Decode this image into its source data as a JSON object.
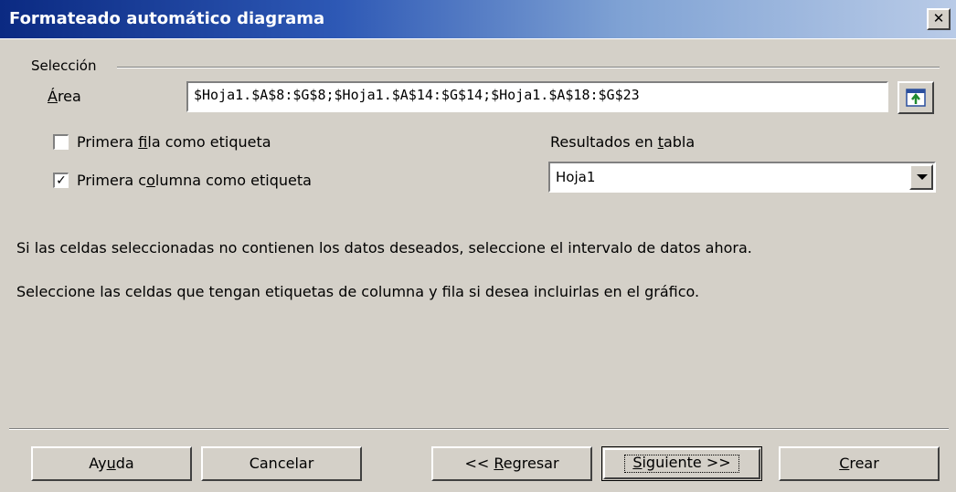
{
  "window": {
    "title": "Formateado automático diagrama",
    "close_glyph": "✕"
  },
  "selection_group": {
    "label": "Selección",
    "area_label_mnemonic": "Á",
    "area_label_rest": "rea",
    "area_value": "$Hoja1.$A$8:$G$8;$Hoja1.$A$14:$G$14;$Hoja1.$A$18:$G$23",
    "shrink_button_icon": "shrink-dialog-icon"
  },
  "options": {
    "first_row": {
      "checked": false,
      "label_pre": "Primera ",
      "mnemonic": "f",
      "label_post": "ila como etiqueta"
    },
    "first_column": {
      "checked": true,
      "label_pre": "Primera c",
      "mnemonic": "o",
      "label_post": "lumna como etiqueta"
    },
    "results_label_pre": "Resultados en ",
    "results_mnemonic": "t",
    "results_label_post": "abla",
    "results_value": "Hoja1"
  },
  "info": {
    "line1": "Si las celdas seleccionadas no contienen los datos deseados, seleccione el intervalo de datos ahora.",
    "line2": "Seleccione las celdas que tengan etiquetas de columna y fila si desea incluirlas en el gráfico."
  },
  "buttons": {
    "help_pre": "Ay",
    "help_mn": "u",
    "help_post": "da",
    "cancel": "Cancelar",
    "back_pre": "<< ",
    "back_mn": "R",
    "back_post": "egresar",
    "next_pre": "",
    "next_mn": "S",
    "next_post": "iguiente >>",
    "create_pre": "",
    "create_mn": "C",
    "create_post": "rear"
  },
  "colors": {
    "title_gradient_start": "#0b2a82",
    "dialog_bg": "#d4d0c8"
  }
}
